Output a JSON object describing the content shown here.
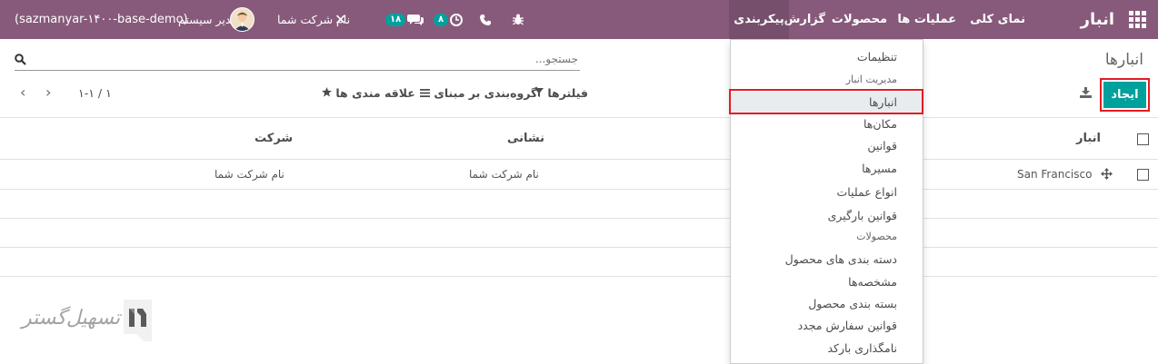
{
  "navbar": {
    "brand": "انبار",
    "menu": [
      "نمای کلی",
      "عملیات ها",
      "محصولات",
      "گزارش",
      "پیکربندی"
    ],
    "database": "(sazmanyar-۱۴۰۰-base-demo)",
    "user_name": "مدیر سیستم",
    "company": "نام شرکت شما",
    "chat_count": "۱۸",
    "activity_count": "۸",
    "accent_color": "#875a7b"
  },
  "control_panel": {
    "breadcrumb": "انبارها",
    "search_placeholder": "جستجو...",
    "create_label": "ایجاد",
    "filters_label": "فیلترها",
    "groupby_label": "گروه‌بندی بر مبنای",
    "favorites_label": "علاقه مندی ها",
    "pager": "۱-۱ / ۱",
    "button_color": "#00a09d"
  },
  "table": {
    "columns": [
      "انبار",
      "نشانی",
      "شرکت"
    ],
    "rows": [
      {
        "warehouse": "San Francisco",
        "address": "نام شرکت شما",
        "company": "نام شرکت شما"
      }
    ]
  },
  "dropdown": {
    "items": [
      {
        "label": "تنظیمات",
        "type": "item"
      },
      {
        "label": "مدیریت انبار",
        "type": "header"
      },
      {
        "label": "انبارها",
        "type": "item",
        "active": true
      },
      {
        "label": "مکان‌ها",
        "type": "item"
      },
      {
        "label": "قوانین",
        "type": "item"
      },
      {
        "label": "مسیرها",
        "type": "item"
      },
      {
        "label": "انواع عملیات",
        "type": "item"
      },
      {
        "label": "قوانین بارگیری",
        "type": "item"
      },
      {
        "label": "محصولات",
        "type": "header"
      },
      {
        "label": "دسته بندی های محصول",
        "type": "item"
      },
      {
        "label": "مشخصه‌ها",
        "type": "item"
      },
      {
        "label": "بسته بندی محصول",
        "type": "item"
      },
      {
        "label": "قوانین سفارش مجدد",
        "type": "item"
      },
      {
        "label": "نامگذاری بارکد",
        "type": "item"
      }
    ]
  },
  "watermark": {
    "text": "تسهیل‌گستر"
  }
}
